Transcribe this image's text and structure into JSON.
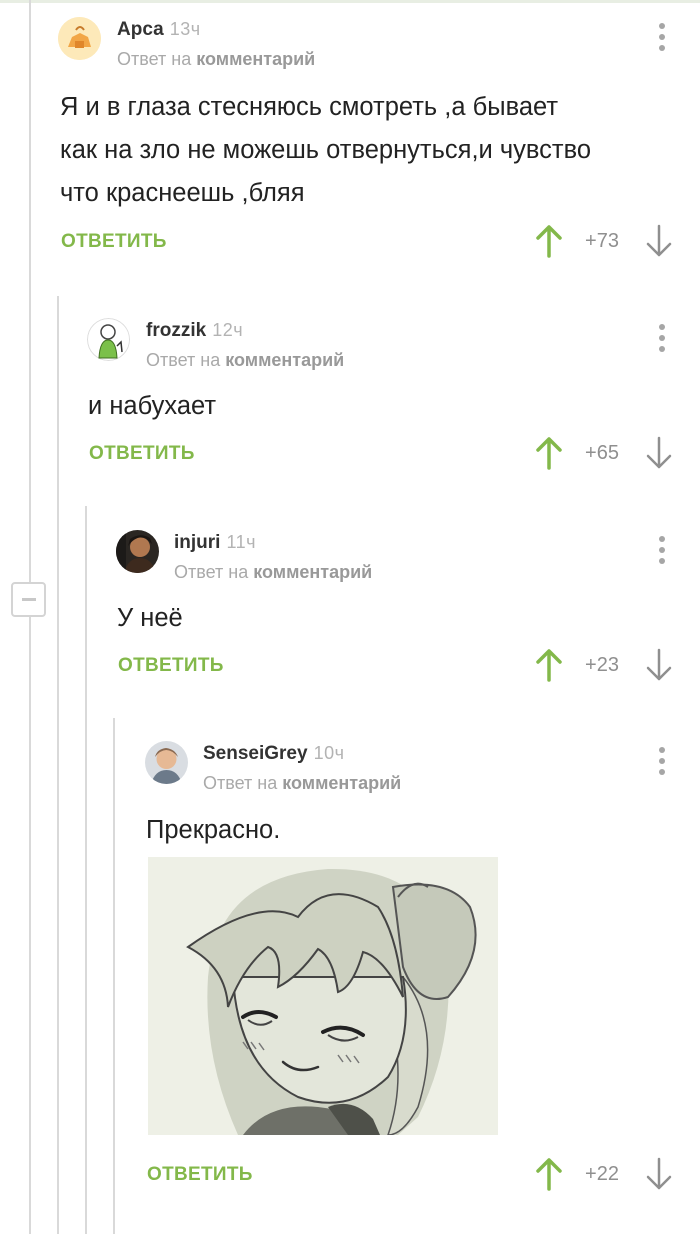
{
  "reply_to_prefix": "Ответ на",
  "reply_to_target": "комментарий",
  "reply_label": "ОТВЕТИТЬ",
  "colors": {
    "accent_green": "#83b84a",
    "muted_text": "#a9a9a9",
    "thread_line": "#d9d9d9"
  },
  "icons": {
    "up": "arrow-up-icon",
    "down": "arrow-down-icon",
    "menu": "more-vertical-icon",
    "collapse": "minus-icon"
  },
  "comments": [
    {
      "author": "Арса",
      "time": "13ч",
      "text_lines": [
        "Я и в глаза стесняюсь смотреть ,а бывает",
        "как на зло не можешь отвернуться,и чувство",
        "что краснеешь ,бляя"
      ],
      "score": "+73"
    },
    {
      "author": "frozzik",
      "time": "12ч",
      "text_lines": [
        "и набухает"
      ],
      "score": "+65"
    },
    {
      "author": "injuri",
      "time": "11ч",
      "text_lines": [
        "У неё"
      ],
      "score": "+23"
    },
    {
      "author": "SenseiGrey",
      "time": "10ч",
      "text_lines": [
        "Прекрасно."
      ],
      "score": "+22",
      "has_image": true
    }
  ]
}
